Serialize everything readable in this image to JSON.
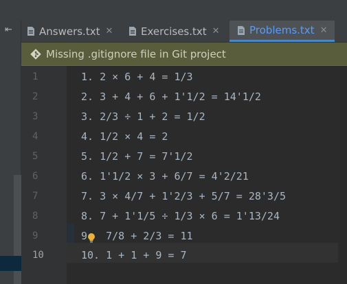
{
  "sidebar": {
    "pin_icon": "pin-left-icon"
  },
  "tabs": [
    {
      "label": "Answers.txt",
      "icon": "text-file-icon",
      "active": false
    },
    {
      "label": "Exercises.txt",
      "icon": "text-file-icon",
      "active": false
    },
    {
      "label": "Problems.txt",
      "icon": "text-file-icon",
      "active": true
    }
  ],
  "banner": {
    "message": "Missing .gitignore file in Git project",
    "icon": "git-icon"
  },
  "editor": {
    "current_line": 10,
    "lines": [
      {
        "num": "1",
        "text": "1. 2 × 6 + 4 = 1/3"
      },
      {
        "num": "2",
        "text": "2. 3 + 4 + 6 + 1'1/2 = 14'1/2"
      },
      {
        "num": "3",
        "text": "3. 2/3 ÷ 1 + 2 = 1/2"
      },
      {
        "num": "4",
        "text": "4. 1/2 × 4 = 2"
      },
      {
        "num": "5",
        "text": "5. 1/2 + 7 = 7'1/2"
      },
      {
        "num": "6",
        "text": "6. 1'1/2 × 3 + 6/7 = 4'2/21"
      },
      {
        "num": "7",
        "text": "7. 3 × 4/7 + 1'2/3 + 5/7 = 28'3/5"
      },
      {
        "num": "8",
        "text": "8. 7 + 1'1/5 ÷ 1/3 × 6 = 1'13/24"
      },
      {
        "num": "9",
        "text": "9.  7/8 + 2/3 = 11"
      },
      {
        "num": "10",
        "text": "10. 1 + 1 + 9 = 7"
      }
    ],
    "intention_icon": "lightbulb-icon"
  },
  "colors": {
    "accent": "#4a88c7",
    "active_tab_text": "#589df6",
    "banner_bg": "#5a5d3b"
  }
}
